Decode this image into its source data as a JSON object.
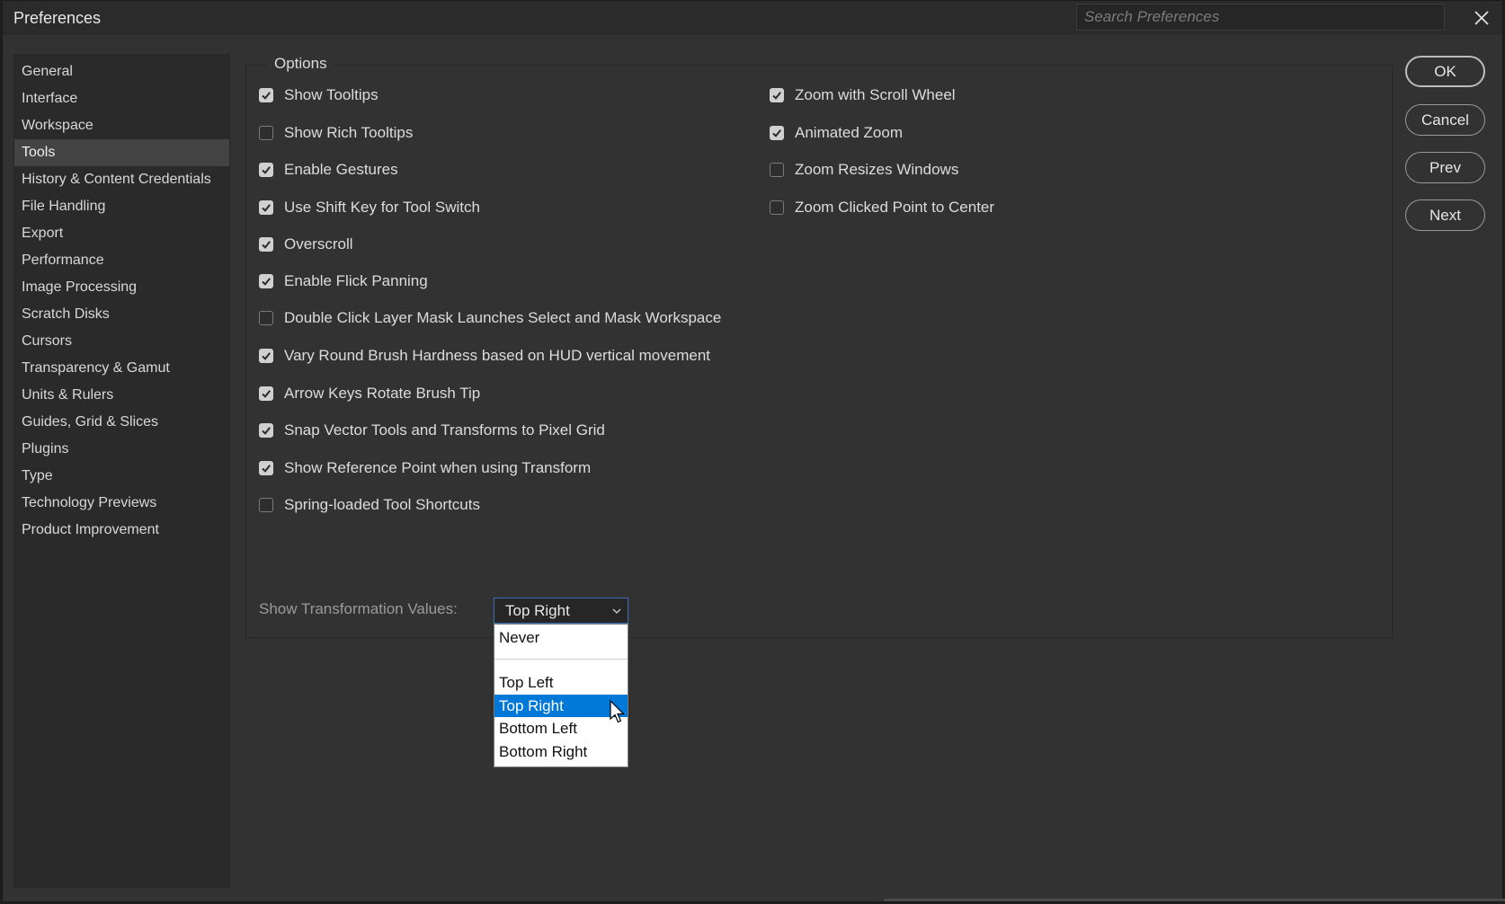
{
  "window": {
    "title": "Preferences"
  },
  "search": {
    "placeholder": "Search Preferences"
  },
  "sidebar": {
    "items": [
      {
        "label": "General"
      },
      {
        "label": "Interface"
      },
      {
        "label": "Workspace"
      },
      {
        "label": "Tools",
        "active": true
      },
      {
        "label": "History & Content Credentials"
      },
      {
        "label": "File Handling"
      },
      {
        "label": "Export"
      },
      {
        "label": "Performance"
      },
      {
        "label": "Image Processing"
      },
      {
        "label": "Scratch Disks"
      },
      {
        "label": "Cursors"
      },
      {
        "label": "Transparency & Gamut"
      },
      {
        "label": "Units & Rulers"
      },
      {
        "label": "Guides, Grid & Slices"
      },
      {
        "label": "Plugins"
      },
      {
        "label": "Type"
      },
      {
        "label": "Technology Previews"
      },
      {
        "label": "Product Improvement"
      }
    ]
  },
  "options": {
    "group_label": "Options",
    "left": [
      {
        "label": "Show Tooltips",
        "checked": true
      },
      {
        "label": "Show Rich Tooltips",
        "checked": false
      },
      {
        "label": "Enable Gestures",
        "checked": true
      },
      {
        "label": "Use Shift Key for Tool Switch",
        "checked": true
      },
      {
        "label": "Overscroll",
        "checked": true
      },
      {
        "label": "Enable Flick Panning",
        "checked": true
      },
      {
        "label": "Double Click Layer Mask Launches Select and Mask Workspace",
        "checked": false
      },
      {
        "label": "Vary Round Brush Hardness based on HUD vertical movement",
        "checked": true
      },
      {
        "label": "Arrow Keys Rotate Brush Tip",
        "checked": true
      },
      {
        "label": "Snap Vector Tools and Transforms to Pixel Grid",
        "checked": true
      },
      {
        "label": "Show Reference Point when using Transform",
        "checked": true
      },
      {
        "label": "Spring-loaded Tool Shortcuts",
        "checked": false
      }
    ],
    "right": [
      {
        "label": "Zoom with Scroll Wheel",
        "checked": true
      },
      {
        "label": "Animated Zoom",
        "checked": true
      },
      {
        "label": "Zoom Resizes Windows",
        "checked": false
      },
      {
        "label": "Zoom Clicked Point to Center",
        "checked": false
      }
    ]
  },
  "transformation": {
    "label": "Show Transformation Values:",
    "selected": "Top Right",
    "options": [
      "Never",
      "Top Left",
      "Top Right",
      "Bottom Left",
      "Bottom Right"
    ]
  },
  "buttons": {
    "ok": "OK",
    "cancel": "Cancel",
    "prev": "Prev",
    "next": "Next"
  }
}
